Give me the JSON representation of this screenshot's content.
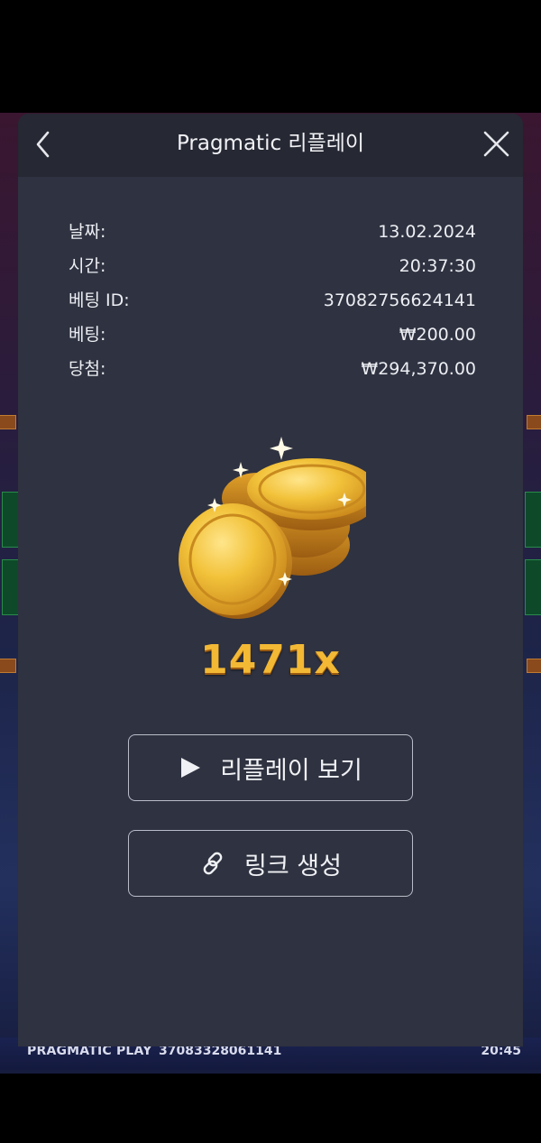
{
  "modal": {
    "title": "Pragmatic 리플레이",
    "back_icon": "chevron-left-icon",
    "close_icon": "close-icon"
  },
  "details": [
    {
      "label": "날짜:",
      "value": "13.02.2024"
    },
    {
      "label": "시간:",
      "value": "20:37:30"
    },
    {
      "label": "베팅 ID:",
      "value": "37082756624141"
    },
    {
      "label": "베팅:",
      "value": "₩200.00"
    },
    {
      "label": "당첨:",
      "value": "₩294,370.00"
    }
  ],
  "win": {
    "image_icon": "gold-coins-icon",
    "multiplier": "1471x"
  },
  "actions": {
    "replay": {
      "label": "리플레이 보기",
      "icon": "play-icon"
    },
    "link": {
      "label": "링크 생성",
      "icon": "link-icon"
    }
  },
  "game_footer": {
    "brand": "PRAGMATIC PLAY",
    "round_id": "37083328061141",
    "time": "20:45"
  },
  "colors": {
    "modal_bg": "#2f3240",
    "header_bg": "#262833",
    "multiplier_gold": "#f3b935",
    "button_border": "#b9bcc8"
  }
}
